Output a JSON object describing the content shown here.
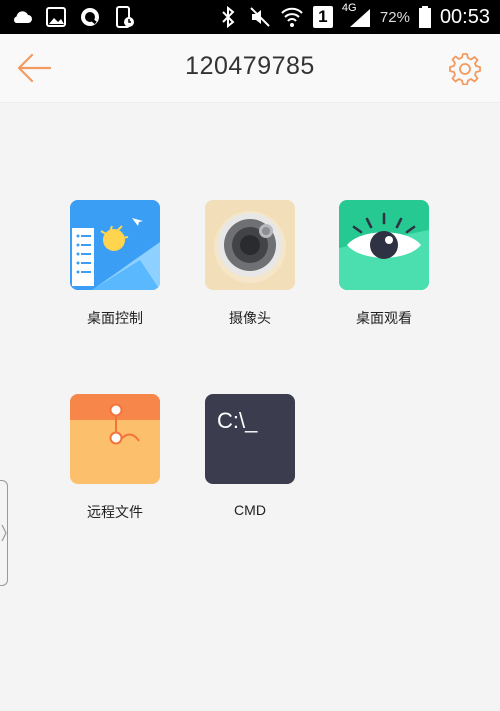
{
  "status_bar": {
    "battery_pct": "72%",
    "time": "00:53",
    "network_type": "4G",
    "sim_slot": "1",
    "icons": [
      "cloud-icon",
      "gallery-icon",
      "qq-icon",
      "phone-clock-icon",
      "bluetooth-icon",
      "mute-icon",
      "wifi-icon",
      "sim-icon",
      "signal-icon",
      "battery-icon"
    ]
  },
  "header": {
    "title": "120479785"
  },
  "tiles": [
    {
      "label": "桌面控制",
      "icon": "desktop-control-icon"
    },
    {
      "label": "摄像头",
      "icon": "camera-icon"
    },
    {
      "label": "桌面观看",
      "icon": "eye-icon"
    },
    {
      "label": "远程文件",
      "icon": "folder-icon"
    },
    {
      "label": "CMD",
      "icon": "cmd-terminal-icon",
      "icon_text": "C:\\_"
    }
  ],
  "colors": {
    "accent": "#f39a60",
    "desktop_control": "#3a9ef5",
    "camera_bg": "#f2deb8",
    "eye_bg": "#3fd7a6",
    "folder_bg": "#f9b462",
    "cmd_bg": "#3b3d4e"
  }
}
